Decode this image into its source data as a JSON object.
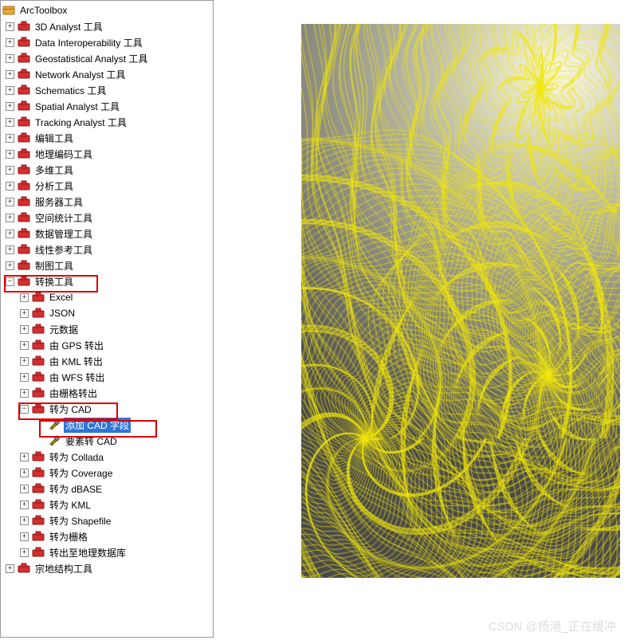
{
  "root": {
    "label": "ArcToolbox"
  },
  "toolboxes": [
    {
      "label": "3D Analyst 工具",
      "expanded": false
    },
    {
      "label": "Data Interoperability 工具",
      "expanded": false
    },
    {
      "label": "Geostatistical Analyst 工具",
      "expanded": false
    },
    {
      "label": "Network Analyst 工具",
      "expanded": false
    },
    {
      "label": "Schematics 工具",
      "expanded": false
    },
    {
      "label": "Spatial Analyst 工具",
      "expanded": false
    },
    {
      "label": "Tracking Analyst 工具",
      "expanded": false
    },
    {
      "label": "编辑工具",
      "expanded": false
    },
    {
      "label": "地理编码工具",
      "expanded": false
    },
    {
      "label": "多维工具",
      "expanded": false
    },
    {
      "label": "分析工具",
      "expanded": false
    },
    {
      "label": "服务器工具",
      "expanded": false
    },
    {
      "label": "空间统计工具",
      "expanded": false
    },
    {
      "label": "数据管理工具",
      "expanded": false
    },
    {
      "label": "线性参考工具",
      "expanded": false
    },
    {
      "label": "制图工具",
      "expanded": false
    }
  ],
  "conversion": {
    "label": "转换工具",
    "children": [
      {
        "label": "Excel",
        "type": "toolset"
      },
      {
        "label": "JSON",
        "type": "toolset"
      },
      {
        "label": "元数据",
        "type": "toolset"
      },
      {
        "label": "由 GPS 转出",
        "type": "toolset"
      },
      {
        "label": "由 KML 转出",
        "type": "toolset"
      },
      {
        "label": "由 WFS 转出",
        "type": "toolset"
      },
      {
        "label": "由栅格转出",
        "type": "toolset"
      }
    ],
    "cad": {
      "label": "转为 CAD",
      "tools": [
        {
          "label": "添加 CAD 字段",
          "selected": true
        },
        {
          "label": "要素转 CAD",
          "selected": false
        }
      ]
    },
    "rest": [
      {
        "label": "转为 Collada"
      },
      {
        "label": "转为 Coverage"
      },
      {
        "label": "转为 dBASE"
      },
      {
        "label": "转为 KML"
      },
      {
        "label": "转为 Shapefile"
      },
      {
        "label": "转为栅格"
      },
      {
        "label": "转出至地理数据库"
      }
    ]
  },
  "last": {
    "label": "宗地结构工具"
  },
  "watermark": "CSDN @杨港_正在缓冲"
}
